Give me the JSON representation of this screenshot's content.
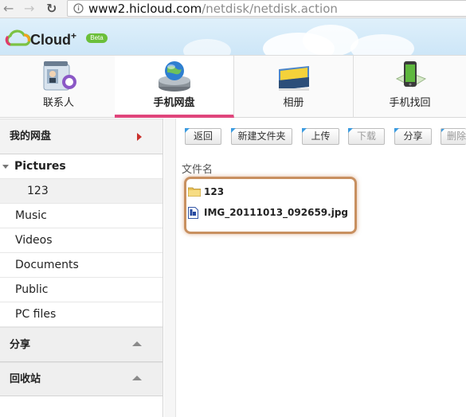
{
  "browser": {
    "url_host": "www2.hicloud.com",
    "url_path": "/netdisk/netdisk.action",
    "back_glyph": "←",
    "forward_glyph": "→",
    "reload_glyph": "↻"
  },
  "header": {
    "logo_text": "Cloud",
    "logo_plus": "+",
    "beta": "Beta"
  },
  "tabs": [
    {
      "label": "联系人",
      "icon": "contacts-icon"
    },
    {
      "label": "手机网盘",
      "icon": "netdisk-icon",
      "active": true
    },
    {
      "label": "相册",
      "icon": "album-icon"
    },
    {
      "label": "手机找回",
      "icon": "phone-finder-icon"
    }
  ],
  "sidebar": {
    "my_disk": "我的网盘",
    "folders": [
      "Pictures",
      "123",
      "Music",
      "Videos",
      "Documents",
      "Public",
      "PC files"
    ],
    "share": "分享",
    "recycle": "回收站"
  },
  "toolbar": {
    "back": "返回",
    "new_folder": "新建文件夹",
    "upload": "上传",
    "download": "下载",
    "share": "分享",
    "delete": "删除"
  },
  "file_list": {
    "column_header": "文件名",
    "items": [
      {
        "name": "123",
        "type": "folder"
      },
      {
        "name": "IMG_20111013_092659.jpg",
        "type": "file"
      }
    ]
  },
  "colors": {
    "active_tab_underline": "#e0467c",
    "highlight_border": "#c89060",
    "my_disk_arrow": "#c9302c",
    "toolbar_corner": "#3b9be0"
  }
}
